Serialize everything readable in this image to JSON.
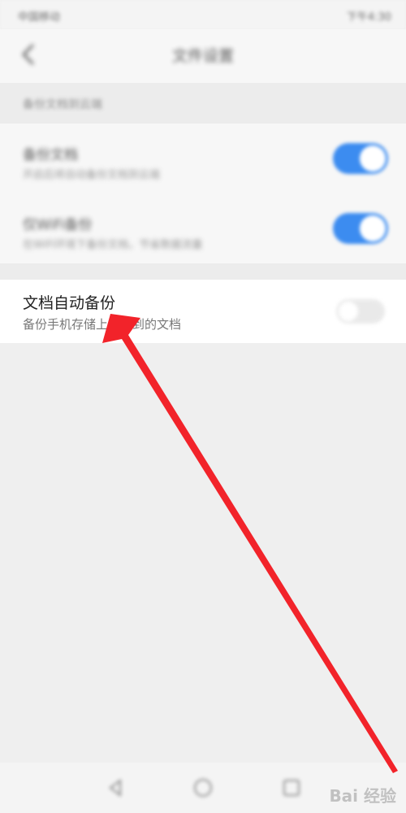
{
  "status_bar": {
    "left_text": "中国移动",
    "right_text": "下午4:30"
  },
  "header": {
    "title": "文件设置"
  },
  "section_caption": "备份文档到云端",
  "settings": [
    {
      "title": "备份文档",
      "subtitle": "开启后将自动备份文档到云端",
      "enabled": true
    },
    {
      "title": "仅WiFi备份",
      "subtitle": "在WiFi环境下备份文档，节省数据流量",
      "enabled": true
    }
  ],
  "backup_row": {
    "title": "文档自动备份",
    "subtitle": "备份手机存储上扫描到的文档",
    "enabled": false
  },
  "watermark": "Bai 经验",
  "colors": {
    "accent": "#3c8cf0",
    "arrow": "#f2232a"
  },
  "icons": {
    "back": "chevron-left-icon",
    "nav": [
      "nav-back-icon",
      "nav-home-icon",
      "nav-recent-icon"
    ]
  }
}
